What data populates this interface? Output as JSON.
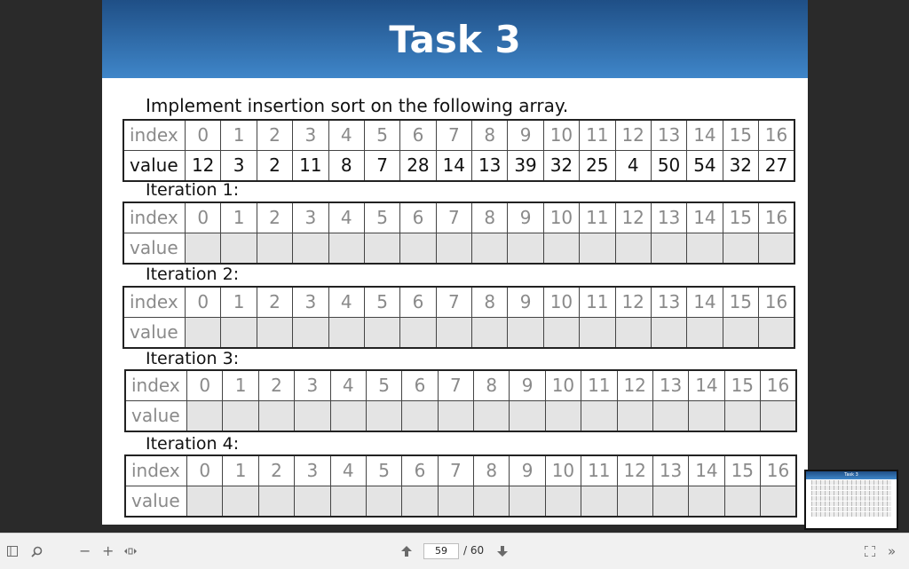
{
  "slide": {
    "title": "Task 3",
    "prompt": "Implement insertion sort on the following array.",
    "index_header": "index",
    "value_header": "value",
    "indices": [
      "0",
      "1",
      "2",
      "3",
      "4",
      "5",
      "6",
      "7",
      "8",
      "9",
      "10",
      "11",
      "12",
      "13",
      "14",
      "15",
      "16"
    ],
    "values": [
      "12",
      "3",
      "2",
      "11",
      "8",
      "7",
      "28",
      "14",
      "13",
      "39",
      "32",
      "25",
      "4",
      "50",
      "54",
      "32",
      "27"
    ],
    "iterations": [
      "Iteration 1:",
      "Iteration 2:",
      "Iteration 3:",
      "Iteration 4:"
    ]
  },
  "thumbnail": {
    "title": "Task 3"
  },
  "toolbar": {
    "page_current": "59",
    "page_total": "/ 60",
    "icons": [
      "sidebar-toggle-icon",
      "search-icon",
      "zoom-out-icon",
      "zoom-in-icon",
      "pan-icon",
      "previous-page-icon",
      "next-page-icon",
      "fullscreen-icon",
      "more-icon"
    ]
  }
}
